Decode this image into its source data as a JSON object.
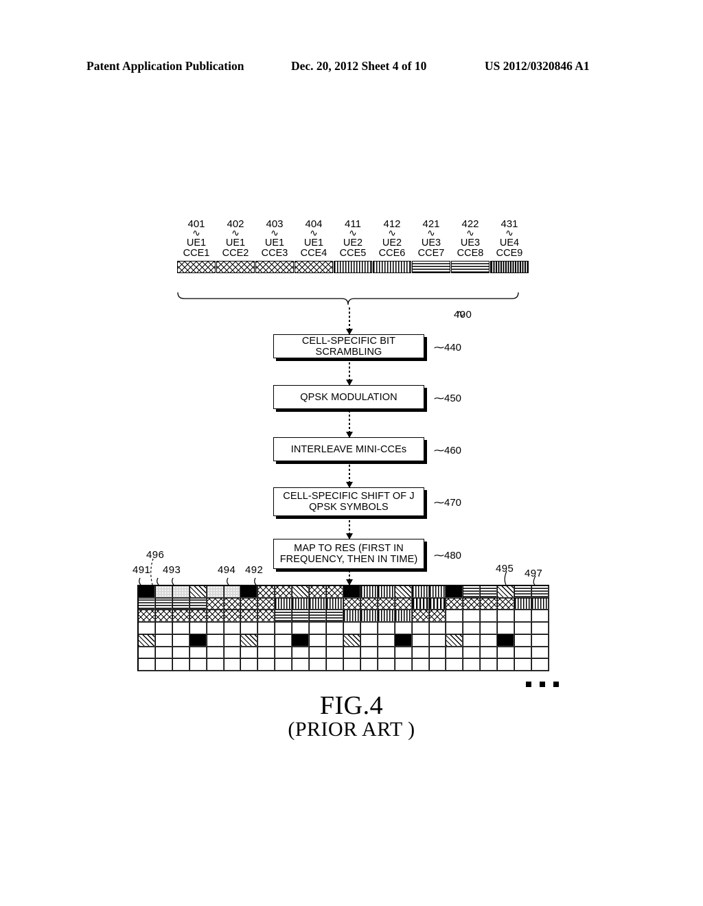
{
  "header": {
    "title": "Patent Application Publication",
    "date_sheet": "Dec. 20, 2012   Sheet 4 of 10",
    "pub_number": "US 2012/0320846 A1"
  },
  "cce_section": {
    "group_ref": "400",
    "blocks": [
      {
        "ref": "401",
        "ue": "UE1",
        "cce": "CCE1",
        "pattern": "crosshatch"
      },
      {
        "ref": "402",
        "ue": "UE1",
        "cce": "CCE2",
        "pattern": "crosshatch"
      },
      {
        "ref": "403",
        "ue": "UE1",
        "cce": "CCE3",
        "pattern": "crosshatch"
      },
      {
        "ref": "404",
        "ue": "UE1",
        "cce": "CCE4",
        "pattern": "crosshatch"
      },
      {
        "ref": "411",
        "ue": "UE2",
        "cce": "CCE5",
        "pattern": "vertical-lines"
      },
      {
        "ref": "412",
        "ue": "UE2",
        "cce": "CCE6",
        "pattern": "vertical-lines"
      },
      {
        "ref": "421",
        "ue": "UE3",
        "cce": "CCE7",
        "pattern": "horizontal-lines"
      },
      {
        "ref": "422",
        "ue": "UE3",
        "cce": "CCE8",
        "pattern": "horizontal-lines"
      },
      {
        "ref": "431",
        "ue": "UE4",
        "cce": "CCE9",
        "pattern": "dense-vertical"
      }
    ]
  },
  "flow_steps": [
    {
      "ref": "440",
      "label": "CELL-SPECIFIC BIT SCRAMBLING"
    },
    {
      "ref": "450",
      "label": "QPSK MODULATION"
    },
    {
      "ref": "460",
      "label": "INTERLEAVE MINI-CCEs"
    },
    {
      "ref": "470",
      "label": "CELL-SPECIFIC SHIFT OF J QPSK SYMBOLS"
    },
    {
      "ref": "480",
      "label": "MAP TO RES (FIRST IN FREQUENCY, THEN IN TIME)"
    }
  ],
  "resource_grid": {
    "refs": [
      "491",
      "492",
      "493",
      "494",
      "495",
      "496",
      "497"
    ],
    "columns": 24,
    "rows": 7,
    "row_patterns": [
      [
        "black",
        "dots",
        "dots",
        "diag",
        "dots",
        "dots",
        "black",
        "cross",
        "cross",
        "diag",
        "cross",
        "cross",
        "black",
        "vert",
        "vert",
        "diag",
        "vert",
        "vert",
        "black",
        "horiz",
        "horiz",
        "diag",
        "horiz",
        "horiz"
      ],
      [
        "horiz",
        "horiz",
        "horiz",
        "horiz",
        "cross",
        "cross",
        "cross",
        "cross",
        "vert",
        "vert",
        "vert",
        "vert",
        "cross",
        "cross",
        "cross",
        "cross",
        "vgray",
        "vgray",
        "cross",
        "cross",
        "cross",
        "cross",
        "vert",
        "vert"
      ],
      [
        "cross",
        "cross",
        "cross",
        "cross",
        "cross",
        "cross",
        "cross",
        "cross",
        "horiz",
        "horiz",
        "horiz",
        "horiz",
        "vert",
        "vert",
        "vert",
        "vert",
        "cross",
        "cross",
        "blank",
        "blank",
        "blank",
        "blank",
        "blank",
        "blank"
      ],
      [
        "blank",
        "blank",
        "blank",
        "blank",
        "blank",
        "blank",
        "blank",
        "blank",
        "blank",
        "blank",
        "blank",
        "blank",
        "blank",
        "blank",
        "blank",
        "blank",
        "blank",
        "blank",
        "blank",
        "blank",
        "blank",
        "blank",
        "blank",
        "blank"
      ],
      [
        "diag",
        "blank",
        "blank",
        "black",
        "blank",
        "blank",
        "diag",
        "blank",
        "blank",
        "black",
        "blank",
        "blank",
        "diag",
        "blank",
        "blank",
        "black",
        "blank",
        "blank",
        "diag",
        "blank",
        "blank",
        "black",
        "blank",
        "blank"
      ],
      [
        "blank",
        "blank",
        "blank",
        "blank",
        "blank",
        "blank",
        "blank",
        "blank",
        "blank",
        "blank",
        "blank",
        "blank",
        "blank",
        "blank",
        "blank",
        "blank",
        "blank",
        "blank",
        "blank",
        "blank",
        "blank",
        "blank",
        "blank",
        "blank"
      ],
      [
        "blank",
        "blank",
        "blank",
        "blank",
        "blank",
        "blank",
        "blank",
        "blank",
        "blank",
        "blank",
        "blank",
        "blank",
        "blank",
        "blank",
        "blank",
        "blank",
        "blank",
        "blank",
        "blank",
        "blank",
        "blank",
        "blank",
        "blank",
        "blank"
      ]
    ]
  },
  "continuation_dots": "...",
  "caption": {
    "figure": "FIG.4",
    "note": "(PRIOR ART )"
  },
  "colors": {
    "ink": "#000000",
    "paper": "#ffffff",
    "gray_fill": "#d9d9d9"
  }
}
